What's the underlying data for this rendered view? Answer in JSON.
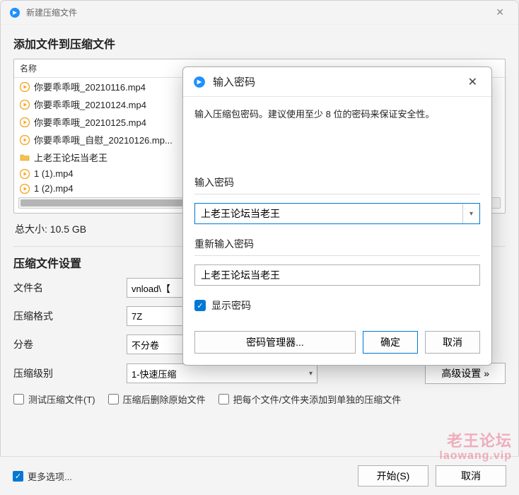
{
  "window": {
    "title": "新建压缩文件"
  },
  "add_section": {
    "heading": "添加文件到压缩文件",
    "name_header": "名称",
    "files": [
      {
        "icon": "play",
        "name": "你要乖乖哦_20210116.mp4"
      },
      {
        "icon": "play",
        "name": "你要乖乖哦_20210124.mp4"
      },
      {
        "icon": "play",
        "name": "你要乖乖哦_20210125.mp4"
      },
      {
        "icon": "play",
        "name": "你要乖乖哦_自慰_20210126.mp..."
      },
      {
        "icon": "folder",
        "name": "上老王论坛当老王"
      },
      {
        "icon": "play",
        "name": "1 (1).mp4"
      },
      {
        "icon": "play",
        "name": "1 (2).mp4"
      }
    ],
    "total_size_label": "总大小: 10.5 GB"
  },
  "settings_section": {
    "heading": "压缩文件设置",
    "filename_label": "文件名",
    "filename_value": "vnload\\【",
    "format_label": "压缩格式",
    "format_value": "7Z",
    "split_label": "分卷",
    "split_value": "不分卷",
    "level_label": "压缩级别",
    "level_value": "1-快速压缩",
    "advanced_label": "高级设置 »",
    "check_test": "测试压缩文件(T)",
    "check_delete": "压缩后删除原始文件",
    "check_separate": "把每个文件/文件夹添加到单独的压缩文件"
  },
  "footer": {
    "more": "更多选项...",
    "start": "开始(S)",
    "cancel": "取消"
  },
  "modal": {
    "title": "输入密码",
    "description": "输入压缩包密码。建议使用至少 8 位的密码来保证安全性。",
    "password_label": "输入密码",
    "password_value": "上老王论坛当老王",
    "reenter_label": "重新输入密码",
    "reenter_value": "上老王论坛当老王",
    "show_password": "显示密码",
    "pwmgr": "密码管理器...",
    "ok": "确定",
    "cancel": "取消"
  },
  "watermark": {
    "line1": "老王论坛",
    "line2": "laowang.vip"
  }
}
